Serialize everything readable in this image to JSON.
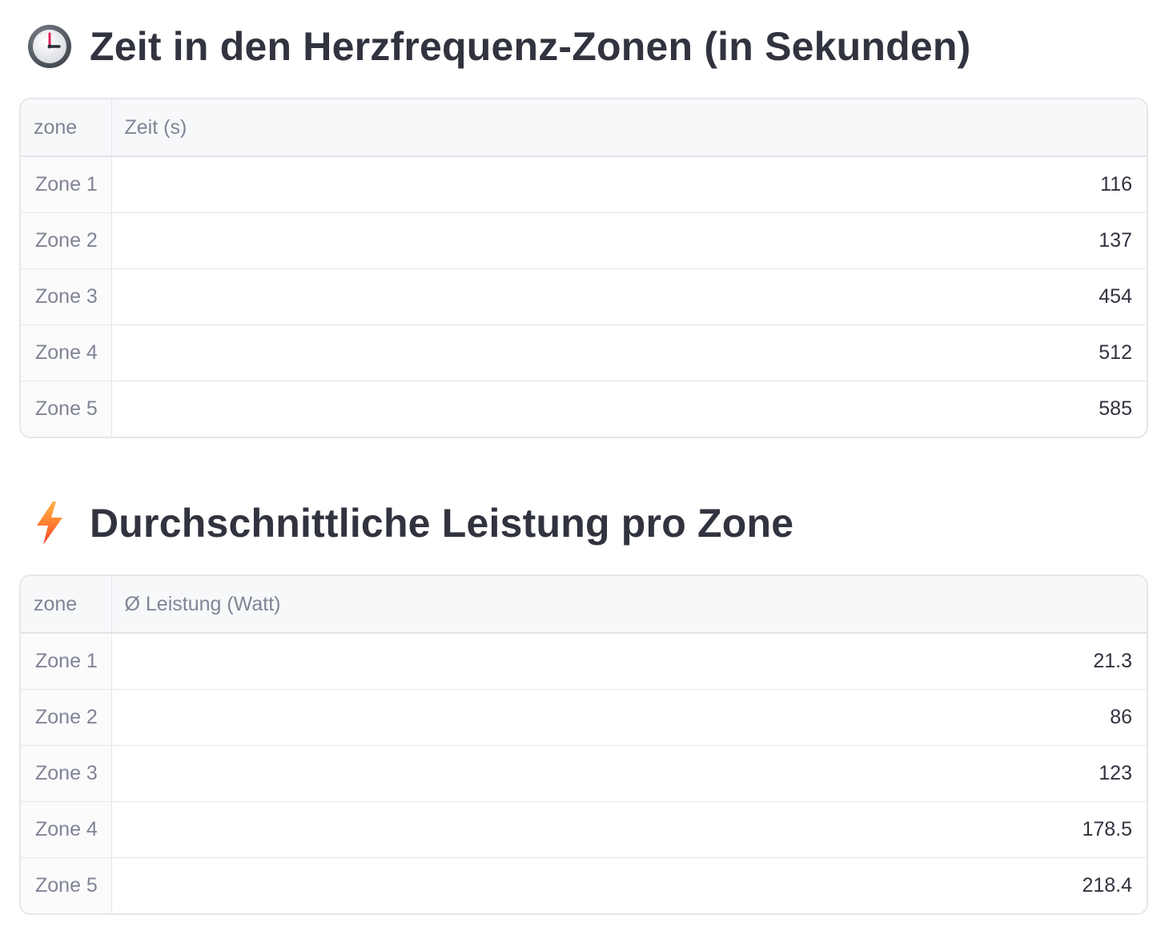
{
  "sections": [
    {
      "icon": "clock-icon",
      "title": "Zeit in den Herzfrequenz-Zonen (in Sekunden)",
      "columns": [
        "zone",
        "Zeit (s)"
      ],
      "rows": [
        {
          "zone": "Zone 1",
          "value": "116"
        },
        {
          "zone": "Zone 2",
          "value": "137"
        },
        {
          "zone": "Zone 3",
          "value": "454"
        },
        {
          "zone": "Zone 4",
          "value": "512"
        },
        {
          "zone": "Zone 5",
          "value": "585"
        }
      ]
    },
    {
      "icon": "lightning-icon",
      "title": "Durchschnittliche Leistung pro Zone",
      "columns": [
        "zone",
        "Ø Leistung (Watt)"
      ],
      "rows": [
        {
          "zone": "Zone 1",
          "value": "21.3"
        },
        {
          "zone": "Zone 2",
          "value": "86"
        },
        {
          "zone": "Zone 3",
          "value": "123"
        },
        {
          "zone": "Zone 4",
          "value": "178.5"
        },
        {
          "zone": "Zone 5",
          "value": "218.4"
        }
      ]
    }
  ]
}
